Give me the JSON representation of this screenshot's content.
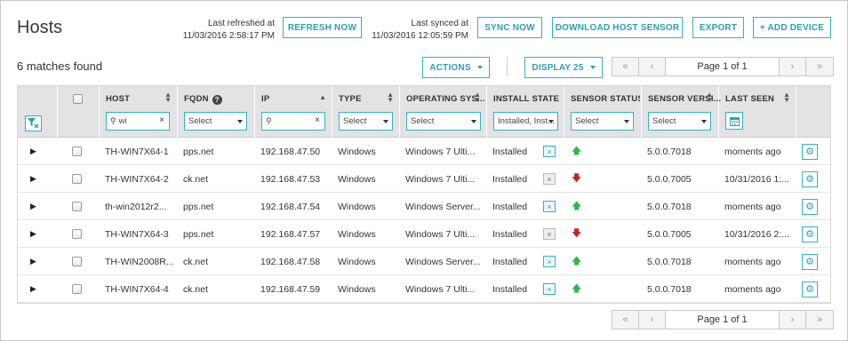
{
  "header": {
    "title": "Hosts",
    "refresh_label": "Last refreshed at",
    "refresh_time": "11/03/2016 2:58:17 PM",
    "sync_label": "Last synced at",
    "sync_time": "11/03/2016 12:05:59 PM"
  },
  "toolbar": {
    "refresh_now": "REFRESH NOW",
    "sync_now": "SYNC NOW",
    "download_sensor": "DOWNLOAD HOST SENSOR",
    "export": "EXPORT",
    "add_device": "+ ADD DEVICE",
    "matches": "6 matches found",
    "actions": "ACTIONS",
    "display": "DISPLAY 25"
  },
  "pager": {
    "first": "«",
    "prev": "‹",
    "page": "Page 1 of 1",
    "next": "›",
    "last": "»"
  },
  "columns": {
    "host": "HOST",
    "fqdn": "FQDN",
    "ip": "IP",
    "type": "TYPE",
    "os": "OPERATING SYS...",
    "install": "INSTALL STATE",
    "sensor_status": "SENSOR STATUS",
    "sensor_version": "SENSOR VERSI...",
    "last_seen": "LAST SEEN"
  },
  "filters": {
    "host": "wi",
    "ip": "",
    "fqdn": "Select",
    "type": "Select",
    "os": "Select",
    "install": "Installed, Inst...",
    "sensor_status": "Select",
    "sensor_version": "Select"
  },
  "icons": {
    "expand": "▶",
    "up_arrow": "🡅",
    "down_arrow": "🡇",
    "gear": "⚙"
  },
  "rows": [
    {
      "host": "TH-WIN7X64-1",
      "fqdn": "pps.net",
      "ip": "192.168.47.50",
      "type": "Windows",
      "os": "Windows 7 Ulti...",
      "install": "Installed",
      "status": "up",
      "version": "5.0.0.7018",
      "last_seen": "moments ago"
    },
    {
      "host": "TH-WIN7X64-2",
      "fqdn": "ck.net",
      "ip": "192.168.47.53",
      "type": "Windows",
      "os": "Windows 7 Ulti...",
      "install": "Installed",
      "status": "down",
      "version": "5.0.0.7005",
      "last_seen": "10/31/2016 1:..."
    },
    {
      "host": "th-win2012r2...",
      "fqdn": "pps.net",
      "ip": "192.168.47.54",
      "type": "Windows",
      "os": "Windows Server...",
      "install": "Installed",
      "status": "up",
      "version": "5.0.0.7018",
      "last_seen": "moments ago"
    },
    {
      "host": "TH-WIN7X64-3",
      "fqdn": "pps.net",
      "ip": "192.168.47.57",
      "type": "Windows",
      "os": "Windows 7 Ulti...",
      "install": "Installed",
      "status": "down",
      "version": "5.0.0.7005",
      "last_seen": "10/31/2016 2:..."
    },
    {
      "host": "TH-WIN2008R...",
      "fqdn": "ck.net",
      "ip": "192.168.47.58",
      "type": "Windows",
      "os": "Windows Server...",
      "install": "Installed",
      "status": "up",
      "version": "5.0.0.7018",
      "last_seen": "moments ago"
    },
    {
      "host": "TH-WIN7X64-4",
      "fqdn": "ck.net",
      "ip": "192.168.47.59",
      "type": "Windows",
      "os": "Windows 7 Ulti...",
      "install": "Installed",
      "status": "up",
      "version": "5.0.0.7018",
      "last_seen": "moments ago"
    }
  ],
  "colors": {
    "accent": "#35b0c7",
    "status_up": "#2db84a",
    "status_down": "#c0272d",
    "header_bg": "#e3e3e3"
  }
}
